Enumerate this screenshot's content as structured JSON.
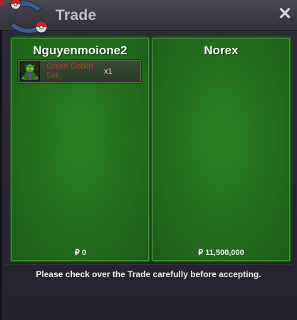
{
  "window": {
    "title": "Trade",
    "logo_icon": "trade-logo-icon",
    "close_icon": "close-icon"
  },
  "left_panel": {
    "player_name": "Nguyenmoione2",
    "items": [
      {
        "icon": "green-goblin-icon",
        "name": "Green Goblin Set",
        "quantity": "x1",
        "name_color": "#c23a2c"
      }
    ],
    "money": "₽ 0"
  },
  "right_panel": {
    "player_name": "Norex",
    "items": [],
    "money": "₽ 11,500,000"
  },
  "footer": {
    "notice": "Please check over the Trade carefully before accepting."
  },
  "colors": {
    "panel_green": "#236d1d",
    "panel_border": "#1f5c18",
    "title_bar": "#3a3a42",
    "window_bg": "#26262e"
  }
}
